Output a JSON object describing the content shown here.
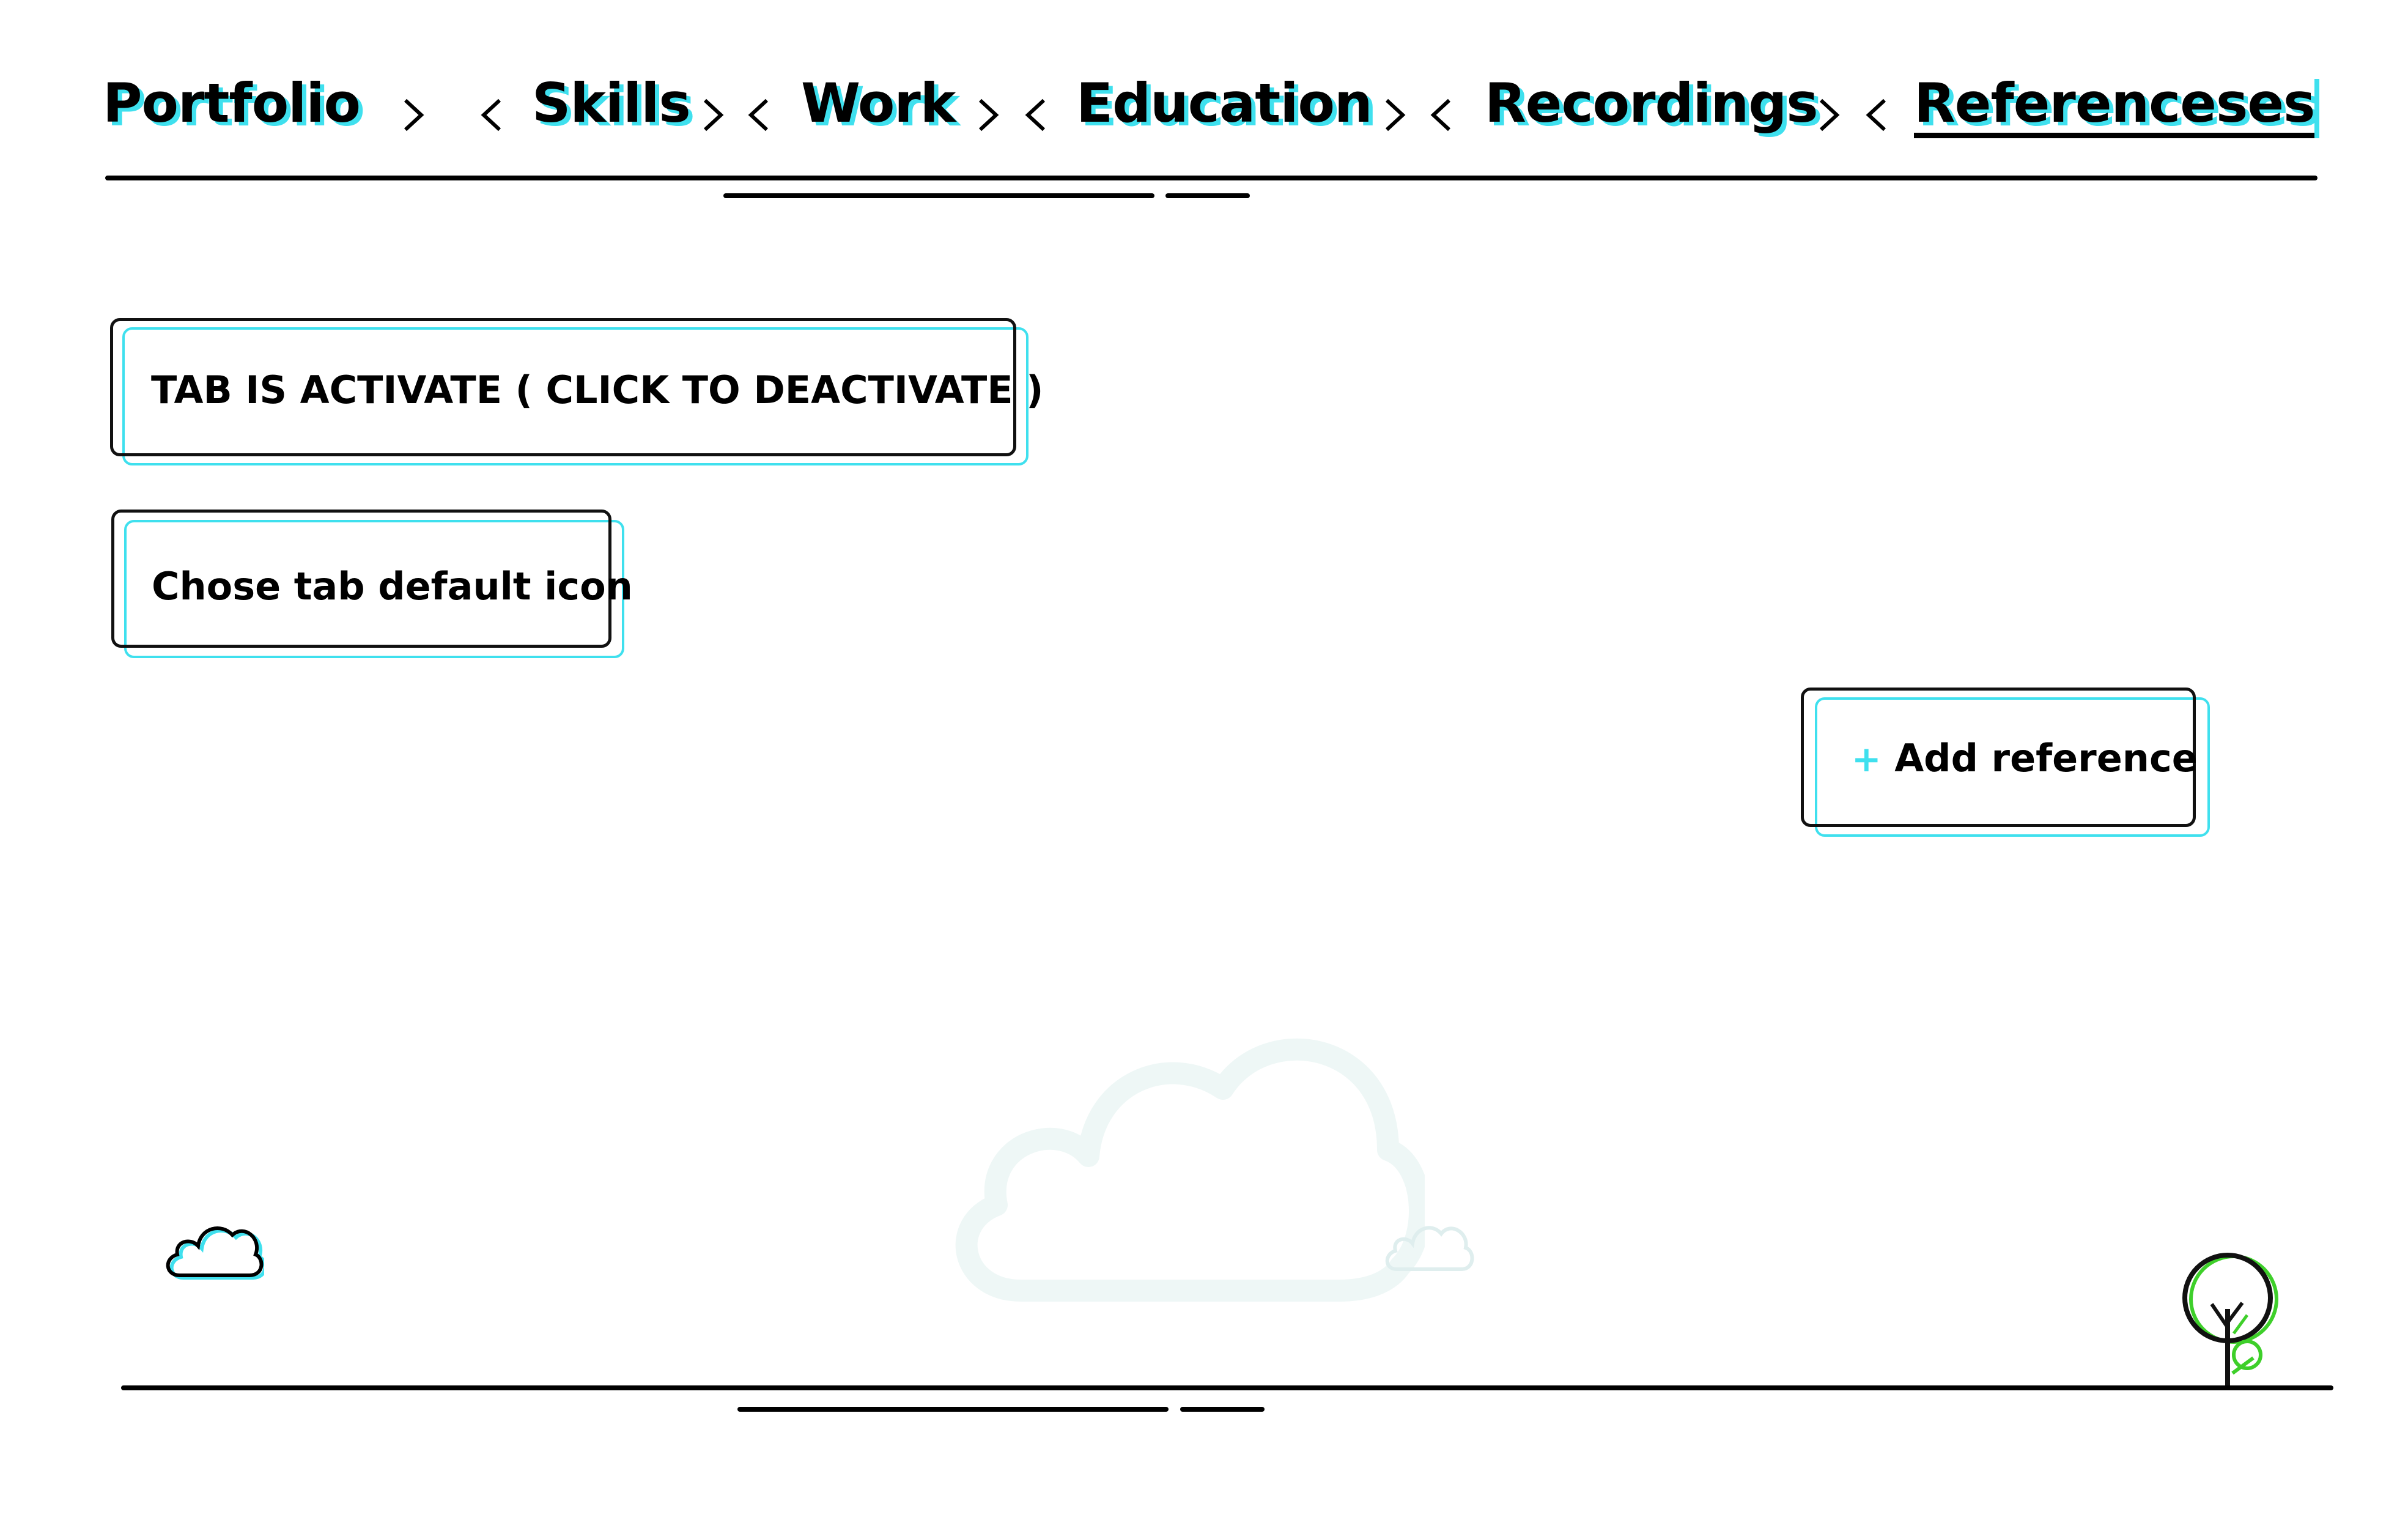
{
  "nav": {
    "items": [
      {
        "label": "Portfolio"
      },
      {
        "label": "Skills"
      },
      {
        "label": "Work"
      },
      {
        "label": "Education"
      },
      {
        "label": "Recordings"
      },
      {
        "label": "Referenceses"
      }
    ],
    "active_index": 5
  },
  "actions": {
    "toggle_tab_label": "TAB IS ACTIVATE ( CLICK TO DEACTIVATE )",
    "default_icon_label": "Chose tab default icon",
    "add_reference_plus": "+",
    "add_reference_label": "Add reference"
  },
  "colors": {
    "accent": "#3fe0ee",
    "ink": "#000000",
    "tree_accent": "#3ecf2a"
  },
  "icons": [
    "chevron-right-icon",
    "chevron-left-icon",
    "cloud-icon",
    "tree-icon",
    "plus-icon"
  ]
}
